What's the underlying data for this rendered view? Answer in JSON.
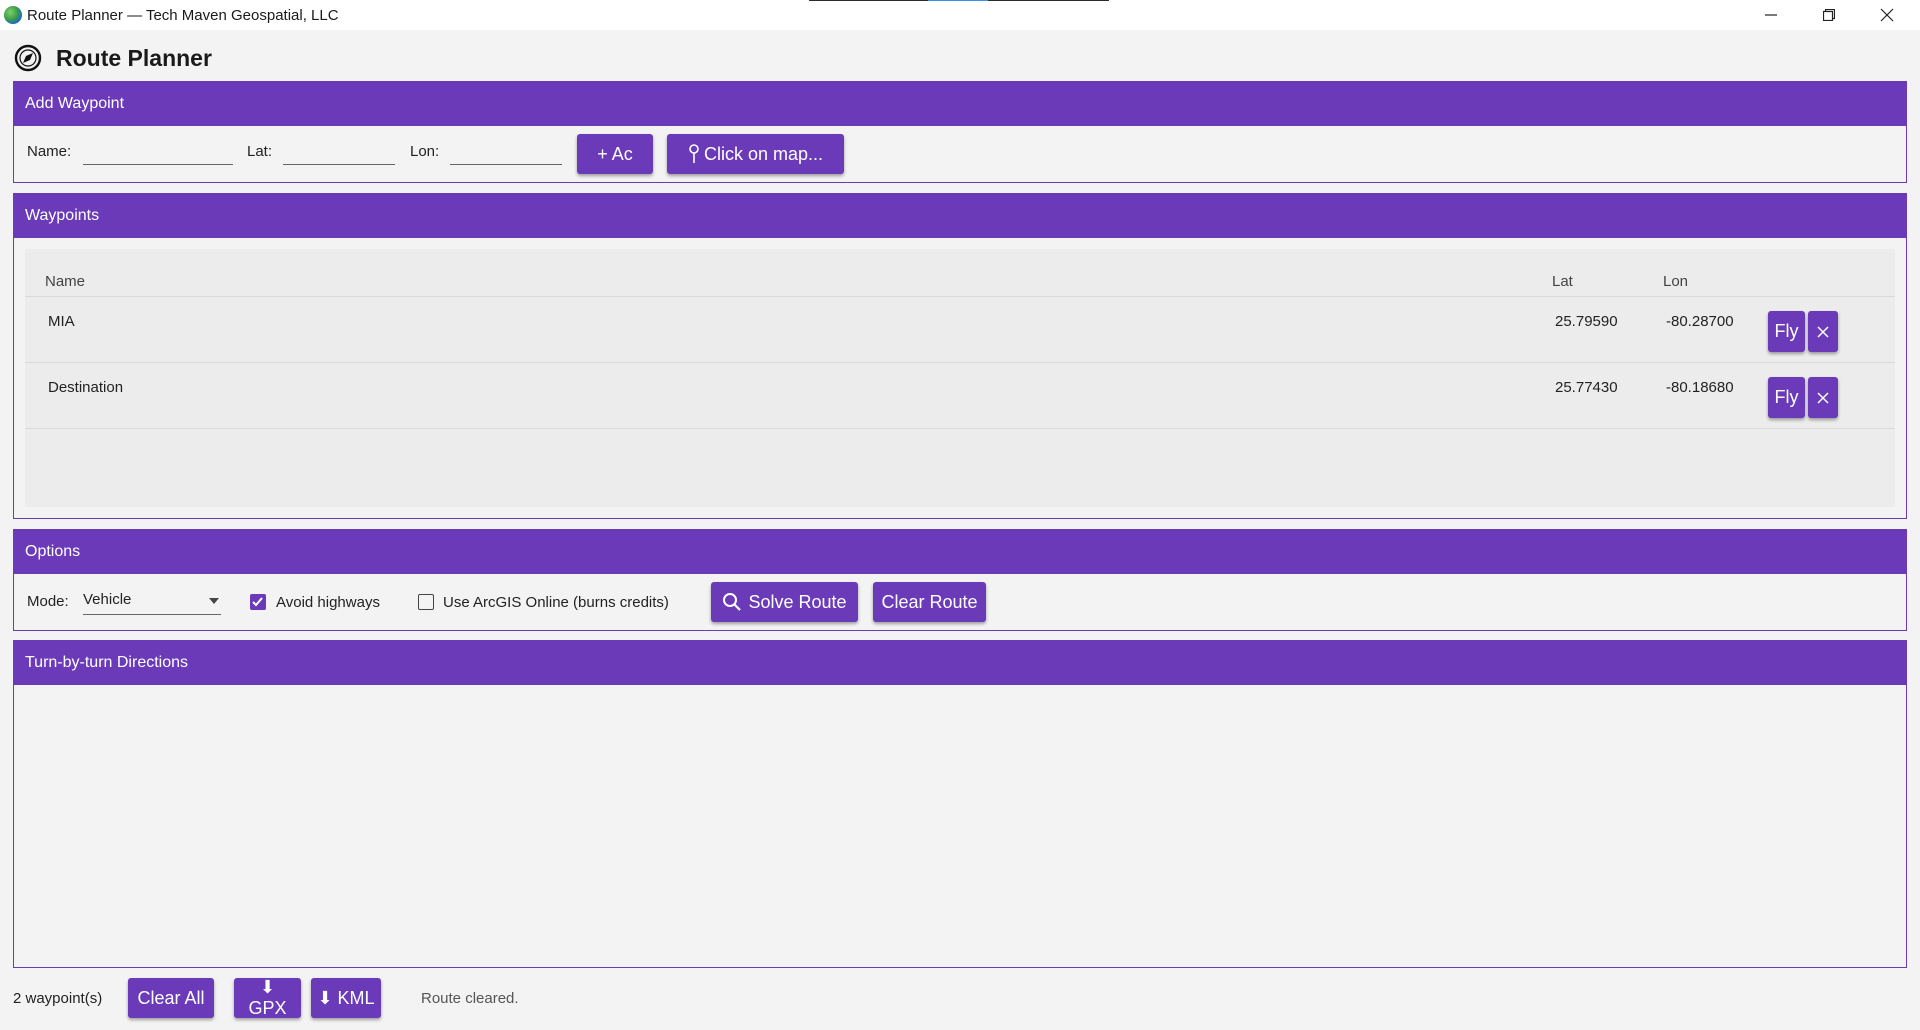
{
  "window": {
    "title": "Route Planner — Tech Maven Geospatial, LLC"
  },
  "header": {
    "title": "Route Planner",
    "icon": "compass-icon"
  },
  "add_waypoint": {
    "heading": "Add Waypoint",
    "name_label": "Name:",
    "lat_label": "Lat:",
    "lon_label": "Lon:",
    "name_value": "",
    "lat_value": "",
    "lon_value": "",
    "add_button": "+ Ac",
    "click_map_button": "Click on map..."
  },
  "waypoints": {
    "heading": "Waypoints",
    "columns": [
      "Name",
      "Lat",
      "Lon"
    ],
    "rows": [
      {
        "name": "MIA",
        "lat": "25.79590",
        "lon": "-80.28700",
        "fly": "Fly"
      },
      {
        "name": "Destination",
        "lat": "25.77430",
        "lon": "-80.18680",
        "fly": "Fly"
      }
    ]
  },
  "options": {
    "heading": "Options",
    "mode_label": "Mode:",
    "mode_value": "Vehicle",
    "avoid_highways_label": "Avoid highways",
    "avoid_highways_checked": true,
    "arcgis_label": "Use ArcGIS Online (burns credits)",
    "arcgis_checked": false,
    "solve_button": "Solve Route",
    "clear_route_button": "Clear Route"
  },
  "directions": {
    "heading": "Turn-by-turn Directions"
  },
  "footer": {
    "count": "2 waypoint(s)",
    "clear_all": "Clear All",
    "gpx": "⬇ GPX",
    "kml": "⬇ KML",
    "status": "Route cleared."
  },
  "colors": {
    "accent": "#6a3ab9",
    "background": "#f3f3f3"
  }
}
